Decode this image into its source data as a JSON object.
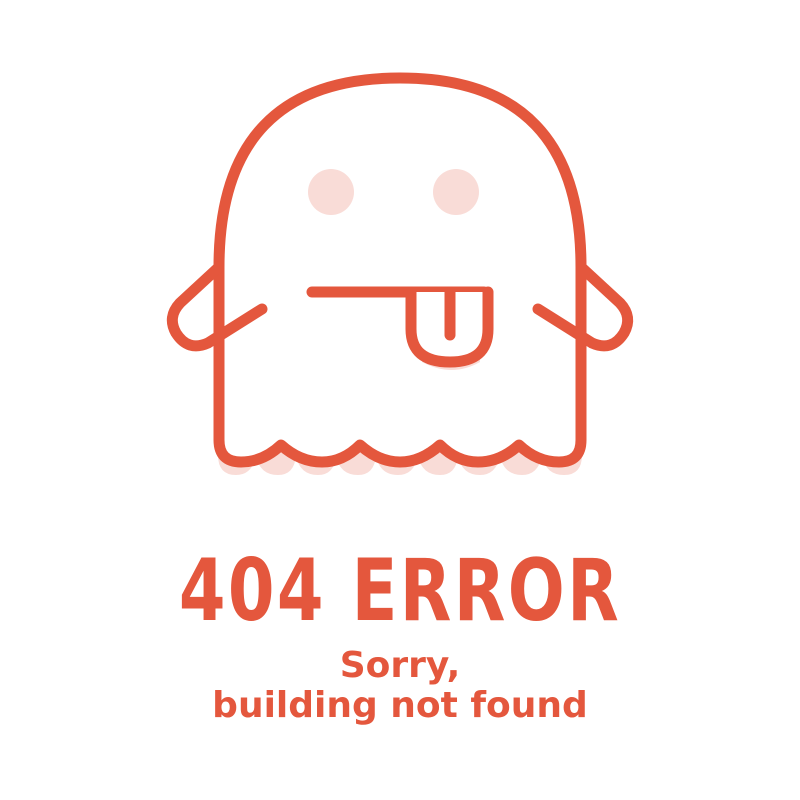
{
  "colors": {
    "accent": "#e4573d",
    "blush": "#f9dcd7",
    "background": "#ffffff"
  },
  "illustration": {
    "icon": "ghost-tongue-out-icon"
  },
  "error": {
    "title": "404 ERROR",
    "message_line1": "Sorry,",
    "message_line2": "building not found"
  }
}
